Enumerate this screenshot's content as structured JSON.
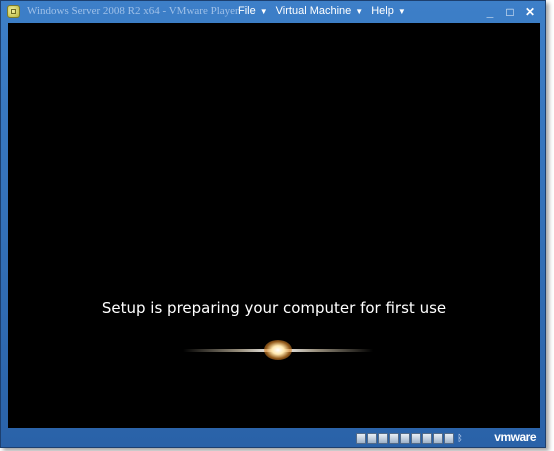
{
  "window": {
    "title": "Windows Server 2008 R2 x64 - VMware Player"
  },
  "menu": [
    {
      "label": "File"
    },
    {
      "label": "Virtual Machine"
    },
    {
      "label": "Help"
    }
  ],
  "window_controls": {
    "minimize": "_",
    "maximize": "□",
    "close": "✕"
  },
  "guest": {
    "status_text": "Setup is preparing your computer for first use"
  },
  "status_bar": {
    "bluetooth_glyph": "ᛒ",
    "brand": "vmware"
  }
}
